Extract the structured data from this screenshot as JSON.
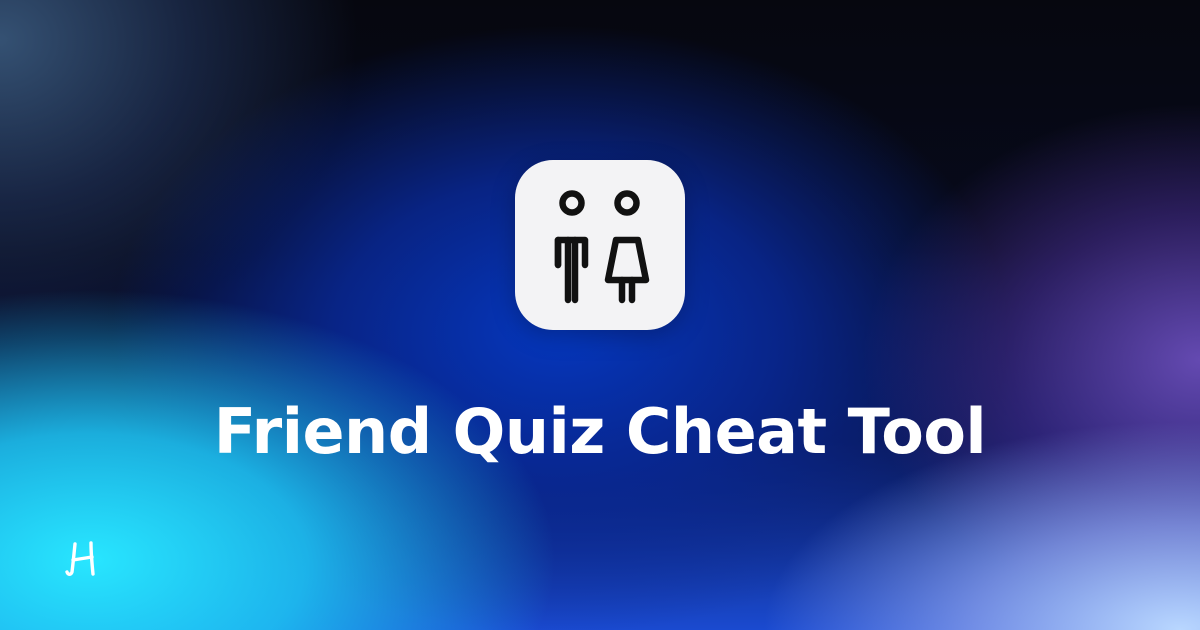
{
  "banner": {
    "title": "Friend Quiz Cheat Tool"
  },
  "icons": {
    "app_icon": "people-icon",
    "brand_logo": "brand-logo-icon"
  },
  "colors": {
    "title_text": "#ffffff",
    "app_icon_background": "#f3f3f5",
    "icon_stroke": "#111111",
    "background_dark": "#06070f",
    "background_blue": "#0537be",
    "background_cyan": "#28e6ff",
    "background_violet": "#6e50be"
  }
}
